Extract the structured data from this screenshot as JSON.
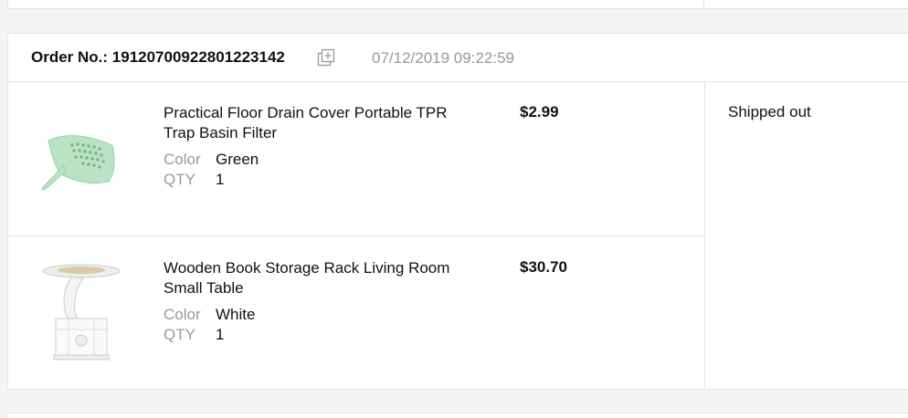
{
  "order": {
    "number_label": "Order No.: 19120700922801223142",
    "date": "07/12/2019 09:22:59",
    "status": "Shipped out",
    "copy_icon": "copy-plus-icon",
    "items": [
      {
        "title": "Practical Floor Drain Cover Portable TPR Trap Basin Filter",
        "price": "$2.99",
        "color_label": "Color",
        "color_value": "Green",
        "qty_label": "QTY",
        "qty_value": "1",
        "image_icon": "floor-drain-cover-thumbnail"
      },
      {
        "title": "Wooden Book Storage Rack Living Room Small Table",
        "price": "$30.70",
        "color_label": "Color",
        "color_value": "White",
        "qty_label": "QTY",
        "qty_value": "1",
        "image_icon": "book-storage-table-thumbnail"
      }
    ]
  },
  "colors": {
    "border": "#e6e6e6",
    "muted_text": "#999999",
    "primary_text": "#111111",
    "background": "#f4f4f4"
  }
}
